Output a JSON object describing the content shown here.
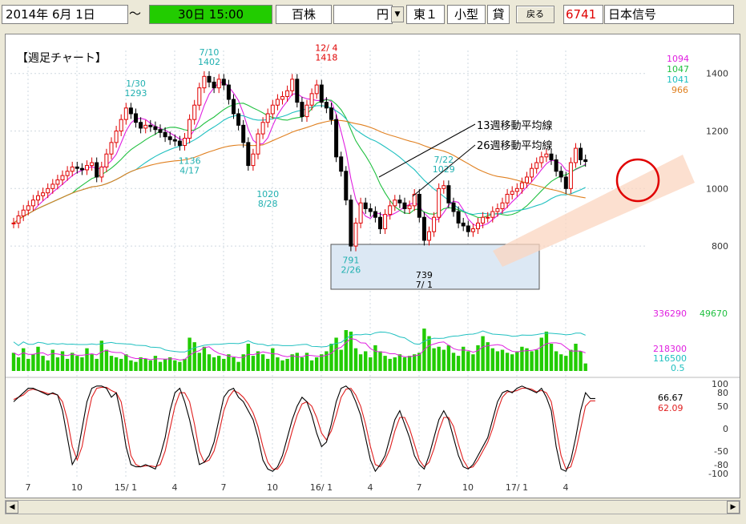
{
  "toolbar": {
    "date_from": "2014年  6月  1日",
    "tilde": "～",
    "date_to": "30日  15:00",
    "unit_label": "百株",
    "currency_value": "円",
    "market": "東１",
    "size_class": "小型",
    "margin_type": "貸",
    "back_label": "戻る",
    "code": "6741",
    "company": "日本信号"
  },
  "chart_title": "【週足チャート】",
  "colors": {
    "ma_fast": "#e020e0",
    "ma_13": "#20c040",
    "ma_26": "#20c0c0",
    "ma_52": "#e08020",
    "volume": "#22cc00",
    "stoch_k": "#000000",
    "stoch_d": "#e02020",
    "up_candle": "#e00000",
    "down_candle": "#000000",
    "annotation_red": "#e00000",
    "annotation_box_fill": "#dce8f4",
    "trend_band": "#fbd6c0"
  },
  "annotations": {
    "label_13w": "13週移動平均線",
    "label_26w": "26週移動平均線"
  },
  "legend": {
    "ma_values": [
      {
        "text": "1094",
        "color": "#e020e0"
      },
      {
        "text": "1047",
        "color": "#20c040"
      },
      {
        "text": "1041",
        "color": "#20c0c0"
      },
      {
        "text": "966",
        "color": "#e08020"
      }
    ],
    "volume_left": "336290",
    "volume_right": "49670",
    "volume_ma1": "218300",
    "volume_ma2": "116500",
    "volume_ratio": "0.5",
    "stoch_k_val": "66.67",
    "stoch_d_val": "62.09"
  },
  "chart_data": {
    "type": "candlestick",
    "price_axis": {
      "ticks": [
        "1400",
        "1200",
        "1000",
        "800"
      ],
      "ylim": [
        700,
        1480
      ]
    },
    "volume_axis": {
      "ylim": [
        0,
        360000
      ]
    },
    "stoch_axis": {
      "ticks": [
        "100",
        "80",
        "50",
        "0",
        "-50",
        "-80",
        "-100"
      ],
      "ylim": [
        -100,
        100
      ]
    },
    "x_labels": [
      "7",
      "10",
      "15/ 1",
      "4",
      "7",
      "10",
      "16/ 1",
      "4",
      "7",
      "10",
      "17/ 1",
      "4"
    ],
    "price_labels": [
      {
        "value": "1293",
        "date": "1/30",
        "color": "#20b0b0"
      },
      {
        "value": "1402",
        "date": "7/10",
        "color": "#20b0b0"
      },
      {
        "value": "1418",
        "date": "12/ 4",
        "color": "#e00000"
      },
      {
        "value": "1136",
        "date": "4/17",
        "color": "#20b0b0"
      },
      {
        "value": "1020",
        "date": "8/28",
        "color": "#20b0b0"
      },
      {
        "value": "791",
        "date": "2/26",
        "color": "#20b0b0"
      },
      {
        "value": "739",
        "date": "7/ 1",
        "color": "#000000"
      },
      {
        "value": "1029",
        "date": "7/22",
        "color": "#20b0b0"
      }
    ],
    "close": [
      880,
      905,
      925,
      940,
      960,
      975,
      985,
      1000,
      1015,
      1030,
      1045,
      1060,
      1075,
      1070,
      1065,
      1080,
      1090,
      1040,
      1075,
      1120,
      1160,
      1200,
      1240,
      1280,
      1260,
      1230,
      1210,
      1220,
      1215,
      1205,
      1195,
      1180,
      1170,
      1165,
      1150,
      1175,
      1240,
      1290,
      1350,
      1390,
      1370,
      1350,
      1380,
      1360,
      1310,
      1260,
      1220,
      1160,
      1080,
      1120,
      1190,
      1230,
      1260,
      1290,
      1310,
      1320,
      1340,
      1380,
      1300,
      1250,
      1290,
      1330,
      1360,
      1300,
      1280,
      1240,
      1110,
      1060,
      960,
      800,
      880,
      950,
      930,
      920,
      900,
      860,
      910,
      940,
      960,
      950,
      930,
      940,
      980,
      900,
      820,
      850,
      900,
      1000,
      1010,
      950,
      920,
      880,
      870,
      850,
      860,
      880,
      900,
      900,
      920,
      930,
      950,
      980,
      990,
      1000,
      1020,
      1040,
      1070,
      1090,
      1110,
      1120,
      1100,
      1060,
      1040,
      1000,
      1090,
      1140,
      1100,
      1094
    ],
    "volume": [
      120000,
      90000,
      150000,
      80000,
      110000,
      160000,
      100000,
      70000,
      140000,
      90000,
      130000,
      80000,
      120000,
      100000,
      90000,
      150000,
      110000,
      80000,
      200000,
      140000,
      100000,
      90000,
      80000,
      110000,
      70000,
      60000,
      90000,
      80000,
      70000,
      100000,
      60000,
      80000,
      90000,
      70000,
      60000,
      80000,
      220000,
      190000,
      120000,
      160000,
      110000,
      90000,
      100000,
      80000,
      110000,
      90000,
      60000,
      110000,
      180000,
      100000,
      130000,
      110000,
      80000,
      150000,
      90000,
      70000,
      80000,
      110000,
      120000,
      90000,
      120000,
      70000,
      90000,
      110000,
      130000,
      180000,
      220000,
      140000,
      270000,
      260000,
      150000,
      110000,
      130000,
      90000,
      170000,
      130000,
      100000,
      80000,
      90000,
      110000,
      90000,
      100000,
      110000,
      120000,
      280000,
      230000,
      150000,
      160000,
      140000,
      170000,
      120000,
      100000,
      160000,
      130000,
      110000,
      170000,
      230000,
      190000,
      150000,
      130000,
      140000,
      120000,
      110000,
      130000,
      160000,
      150000,
      130000,
      140000,
      220000,
      260000,
      180000,
      130000,
      110000,
      100000,
      140000,
      180000,
      130000,
      49670
    ],
    "stoch_k": [
      60,
      70,
      80,
      90,
      90,
      85,
      80,
      75,
      80,
      75,
      40,
      -20,
      -80,
      -60,
      0,
      60,
      90,
      95,
      95,
      90,
      70,
      80,
      30,
      -40,
      -80,
      -85,
      -85,
      -80,
      -85,
      -90,
      -60,
      -20,
      40,
      80,
      90,
      60,
      20,
      -30,
      -80,
      -75,
      -60,
      -30,
      20,
      70,
      85,
      90,
      70,
      60,
      40,
      20,
      -20,
      -70,
      -90,
      -95,
      -85,
      -60,
      -20,
      20,
      50,
      70,
      60,
      30,
      -10,
      -40,
      -30,
      10,
      60,
      90,
      95,
      85,
      60,
      30,
      -20,
      -70,
      -95,
      -80,
      -60,
      -20,
      20,
      40,
      10,
      -20,
      -60,
      -80,
      -90,
      -60,
      -20,
      20,
      40,
      20,
      -20,
      -60,
      -85,
      -90,
      -80,
      -60,
      -40,
      -20,
      20,
      60,
      80,
      85,
      80,
      90,
      95,
      90,
      85,
      80,
      90,
      70,
      40,
      -40,
      -90,
      -95,
      -70,
      -20,
      40,
      80,
      67,
      67
    ],
    "stoch_d": [
      65,
      70,
      75,
      85,
      88,
      85,
      82,
      78,
      78,
      75,
      60,
      20,
      -40,
      -70,
      -40,
      20,
      70,
      90,
      92,
      92,
      85,
      80,
      60,
      0,
      -60,
      -80,
      -85,
      -83,
      -83,
      -85,
      -80,
      -50,
      0,
      50,
      80,
      80,
      60,
      10,
      -50,
      -75,
      -70,
      -50,
      -10,
      40,
      70,
      85,
      80,
      70,
      55,
      35,
      5,
      -40,
      -75,
      -90,
      -90,
      -75,
      -45,
      -5,
      30,
      55,
      60,
      50,
      25,
      -10,
      -25,
      -5,
      30,
      70,
      88,
      90,
      75,
      50,
      10,
      -40,
      -80,
      -85,
      -70,
      -45,
      -5,
      25,
      25,
      0,
      -35,
      -70,
      -85,
      -75,
      -45,
      -5,
      25,
      25,
      5,
      -35,
      -70,
      -88,
      -85,
      -70,
      -50,
      -30,
      0,
      40,
      70,
      82,
      82,
      85,
      90,
      90,
      88,
      82,
      85,
      80,
      60,
      0,
      -60,
      -90,
      -85,
      -50,
      0,
      50,
      62,
      62
    ]
  }
}
